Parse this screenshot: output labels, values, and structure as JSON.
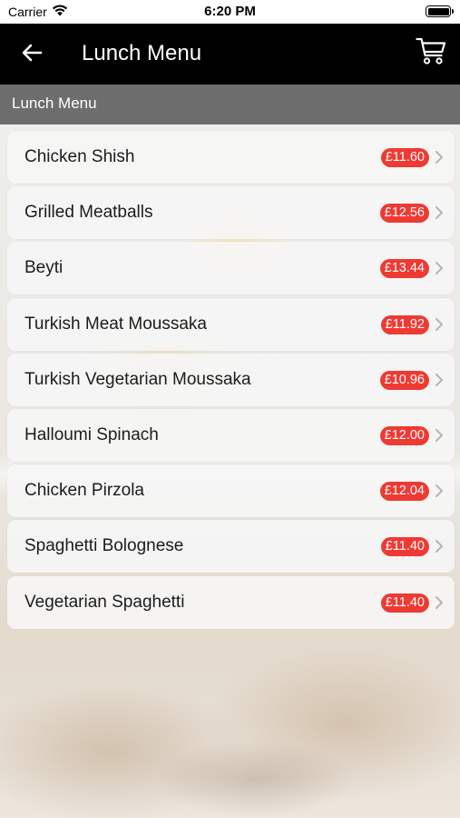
{
  "status_bar": {
    "carrier": "Carrier",
    "time": "6:20 PM"
  },
  "nav": {
    "title": "Lunch Menu",
    "back_icon": "arrow-left-icon",
    "cart_icon": "shopping-cart-icon"
  },
  "section": {
    "title": "Lunch Menu"
  },
  "colors": {
    "nav_background": "#000000",
    "section_background": "#6d6d6d",
    "price_badge": "#ee3a33"
  },
  "menu_items": [
    {
      "name": "Chicken Shish",
      "price": "£11.60"
    },
    {
      "name": "Grilled Meatballs",
      "price": "£12.56"
    },
    {
      "name": "Beyti",
      "price": "£13.44"
    },
    {
      "name": "Turkish Meat Moussaka",
      "price": "£11.92"
    },
    {
      "name": "Turkish Vegetarian Moussaka",
      "price": "£10.96"
    },
    {
      "name": "Halloumi Spinach",
      "price": "£12.00"
    },
    {
      "name": "Chicken Pirzola",
      "price": "£12.04"
    },
    {
      "name": "Spaghetti Bolognese",
      "price": "£11.40"
    },
    {
      "name": "Vegetarian Spaghetti",
      "price": "£11.40"
    }
  ]
}
